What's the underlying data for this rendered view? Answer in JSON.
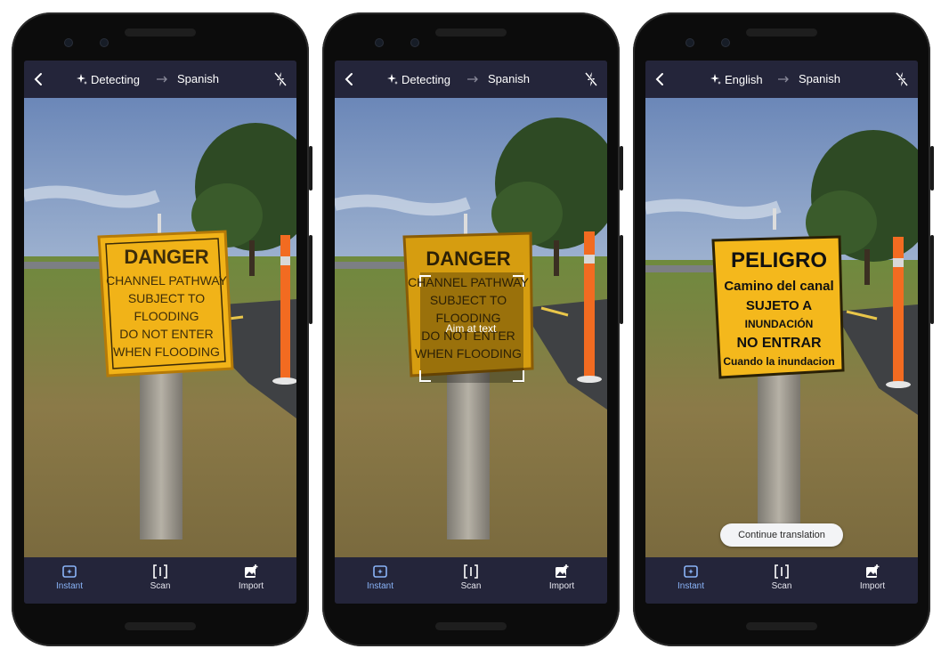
{
  "phones": [
    {
      "source_lang": "Detecting",
      "target_lang": "Spanish",
      "sign_lines": [
        "DANGER",
        "CHANNEL PATHWAY",
        "SUBJECT TO",
        "FLOODING",
        "DO NOT ENTER",
        "WHEN FLOODING"
      ],
      "tabs": [
        {
          "label": "Instant"
        },
        {
          "label": "Scan"
        },
        {
          "label": "Import"
        }
      ]
    },
    {
      "source_lang": "Detecting",
      "target_lang": "Spanish",
      "sign_lines": [
        "DANGER",
        "CHANNEL PATHWAY",
        "SUBJECT TO",
        "FLOODING",
        "DO NOT ENTER",
        "WHEN FLOODING"
      ],
      "aim_text": "Aim at text",
      "tabs": [
        {
          "label": "Instant"
        },
        {
          "label": "Scan"
        },
        {
          "label": "Import"
        }
      ]
    },
    {
      "source_lang": "English",
      "target_lang": "Spanish",
      "sign_lines": [
        "PELIGRO",
        "Camino del canal",
        "SUJETO A",
        "INUNDACIÓN",
        "NO ENTRAR",
        "Cuando la inundacion"
      ],
      "continue_label": "Continue translation",
      "tabs": [
        {
          "label": "Instant"
        },
        {
          "label": "Scan"
        },
        {
          "label": "Import"
        }
      ]
    }
  ],
  "colors": {
    "bar": "#24253a",
    "active_tab": "#8ab4f8",
    "sign": "#f1b318",
    "post": "#f26b21"
  },
  "icons": {
    "back": "back-arrow-icon",
    "sparkle": "sparkle-icon",
    "arrow": "arrow-right-icon",
    "flash": "flash-off-icon",
    "instant": "instant-camera-icon",
    "scan": "scan-icon",
    "import": "import-image-icon"
  }
}
